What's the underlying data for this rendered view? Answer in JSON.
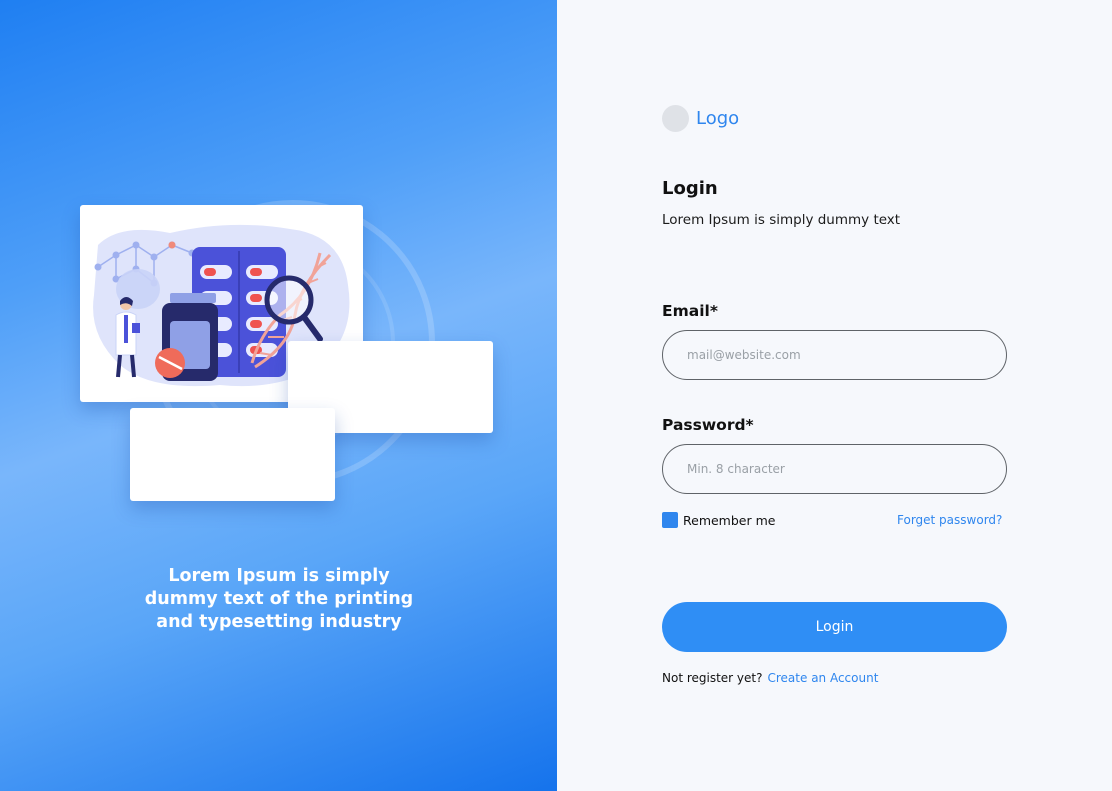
{
  "brand": {
    "logo_text": "Logo"
  },
  "hero": {
    "tagline": "Lorem Ipsum is simply\ndummy text of the printing\nand typesetting industry"
  },
  "form": {
    "title": "Login",
    "subtitle": "Lorem Ipsum is simply dummy text",
    "email_label": "Email*",
    "email_placeholder": "mail@website.com",
    "password_label": "Password*",
    "password_placeholder": "Min. 8 character",
    "remember_label": "Remember me",
    "remember_checked": true,
    "forgot_label": "Forget password?",
    "submit_label": "Login",
    "register_prompt": "Not register yet?",
    "register_link": "Create an Account"
  },
  "colors": {
    "accent": "#2f86ee",
    "button": "#2f8ef5",
    "panel_gradient_start": "#1f7ff2",
    "panel_gradient_end": "#1573ec",
    "right_background": "#f6f8fc"
  },
  "icons": [
    "logo-placeholder-icon",
    "checkbox-checked-icon",
    "medical-illustration"
  ]
}
